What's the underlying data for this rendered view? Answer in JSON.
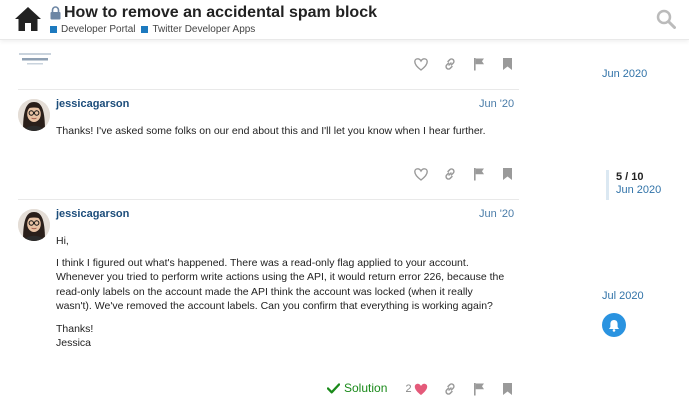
{
  "header": {
    "title": "How to remove an accidental spam block",
    "categories": [
      {
        "label": "Developer Portal",
        "color": "#1d7abf"
      },
      {
        "label": "Twitter Developer Apps",
        "color": "#1d7abf"
      }
    ]
  },
  "posts": [
    {
      "username": "jessicagarson",
      "date": "Jun '20",
      "paragraphs": [
        "Thanks! I've asked some folks on our end about this and I'll let you know when I hear further."
      ]
    },
    {
      "username": "jessicagarson",
      "date": "Jun '20",
      "paragraphs": [
        "Hi,",
        "I think I figured out what's happened. There was a read-only flag applied to your account. Whenever you tried to perform write actions using the API, it would return error 226, because the read-only labels on the account made the API think the account was locked (when it really wasn't). We've removed the account labels. Can you confirm that everything is working again?",
        "Thanks!\nJessica"
      ],
      "solution_label": "Solution",
      "like_count": "2"
    }
  ],
  "timeline": {
    "top_date": "Jun 2020",
    "position": "5 / 10",
    "current_date": "Jun 2020",
    "bottom_date": "Jul 2020"
  },
  "icons": [
    "home-icon",
    "lock-icon",
    "search-icon",
    "heart-icon",
    "link-icon",
    "flag-icon",
    "bookmark-icon",
    "check-icon",
    "bell-icon"
  ],
  "colors": {
    "accent": "#2a93e0",
    "link": "#3173a8",
    "solution": "#1a8a1a",
    "heart": "#e45a7a"
  }
}
